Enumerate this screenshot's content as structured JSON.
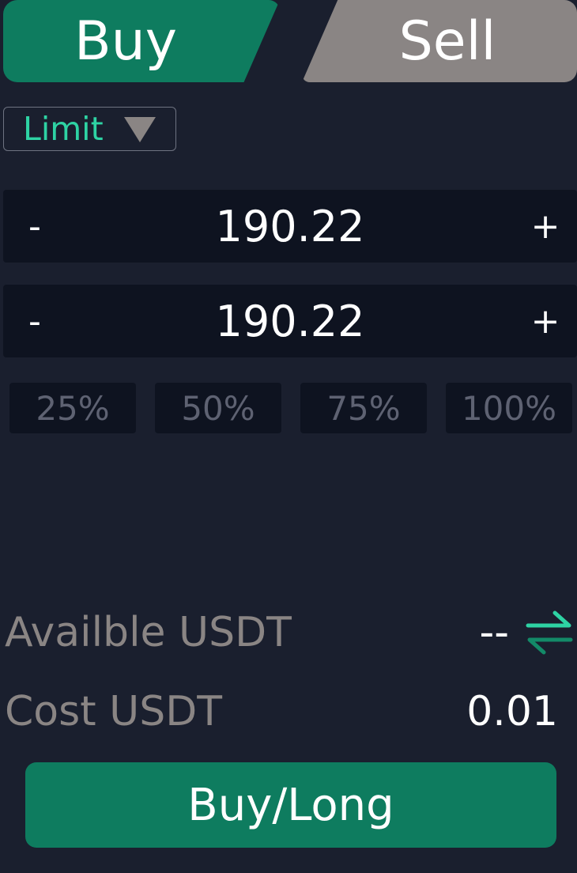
{
  "tabs": {
    "buy": "Buy",
    "sell": "Sell",
    "active": "buy"
  },
  "order_type": {
    "label": "Limit",
    "icon": "triangle-down-icon"
  },
  "price_stepper": {
    "minus": "-",
    "value": "190.22",
    "plus": "+"
  },
  "amount_stepper": {
    "minus": "-",
    "value": "190.22",
    "plus": "+"
  },
  "percent_buttons": [
    "25%",
    "50%",
    "75%",
    "100%"
  ],
  "available": {
    "label": "Availble USDT",
    "value": "--",
    "icon": "swap-arrows-icon"
  },
  "cost": {
    "label": "Cost USDT",
    "value": "0.01"
  },
  "submit": {
    "label": "Buy/Long"
  },
  "colors": {
    "background": "#1a1f2e",
    "input_bg": "#0e1320",
    "buy_green": "#0e7c5f",
    "accent_teal": "#2ed3a4",
    "sell_gray": "#8a8584"
  }
}
